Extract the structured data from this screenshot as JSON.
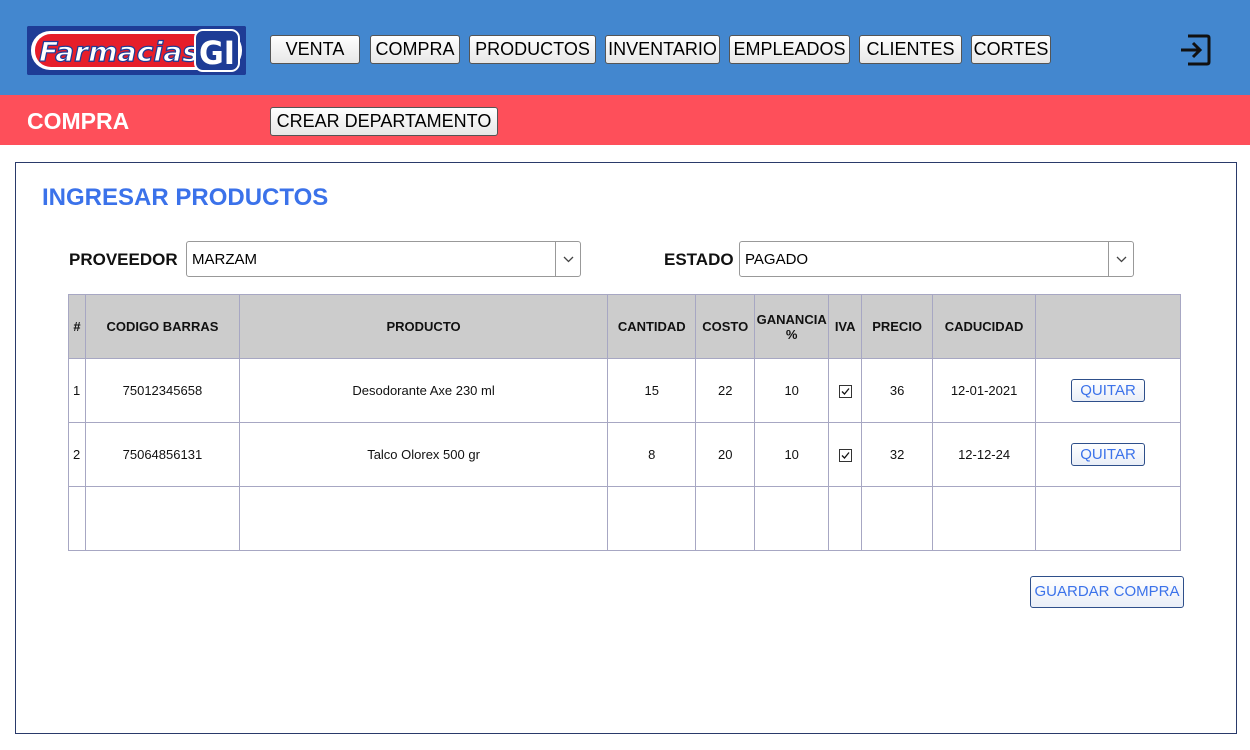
{
  "app": {
    "logo_text": "Farmacias GI"
  },
  "nav": {
    "items": [
      {
        "label": "VENTA"
      },
      {
        "label": "COMPRA"
      },
      {
        "label": "PRODUCTOS"
      },
      {
        "label": "INVENTARIO"
      },
      {
        "label": "EMPLEADOS"
      },
      {
        "label": "CLIENTES"
      },
      {
        "label": "CORTES"
      }
    ]
  },
  "subheader": {
    "title": "COMPRA",
    "create_department_label": "CREAR DEPARTAMENTO"
  },
  "panel": {
    "title": "INGRESAR PRODUCTOS",
    "supplier_label": "PROVEEDOR",
    "supplier_value": "MARZAM",
    "status_label": "ESTADO",
    "status_value": "PAGADO"
  },
  "table": {
    "headers": {
      "num": "#",
      "barcode": "CODIGO BARRAS",
      "product": "PRODUCTO",
      "quantity": "CANTIDAD",
      "cost": "COSTO",
      "profit": "GANANCIA %",
      "iva": "IVA",
      "price": "PRECIO",
      "expiry": "CADUCIDAD"
    },
    "rows": [
      {
        "num": "1",
        "barcode": "75012345658",
        "product": "Desodorante Axe 230 ml",
        "quantity": "15",
        "cost": "22",
        "profit": "10",
        "iva_checked": true,
        "price": "36",
        "expiry": "12-01-2021",
        "action": "QUITAR"
      },
      {
        "num": "2",
        "barcode": "75064856131",
        "product": "Talco Olorex 500 gr",
        "quantity": "8",
        "cost": "20",
        "profit": "10",
        "iva_checked": true,
        "price": "32",
        "expiry": "12-12-24",
        "action": "QUITAR"
      }
    ]
  },
  "save_label": "GUARDAR COMPRA",
  "colors": {
    "header_blue": "#4387cf",
    "subheader_red": "#fe4f5a",
    "title_blue": "#3b72ea",
    "logo_navy": "#1e3c96",
    "logo_red": "#e61e2a"
  }
}
